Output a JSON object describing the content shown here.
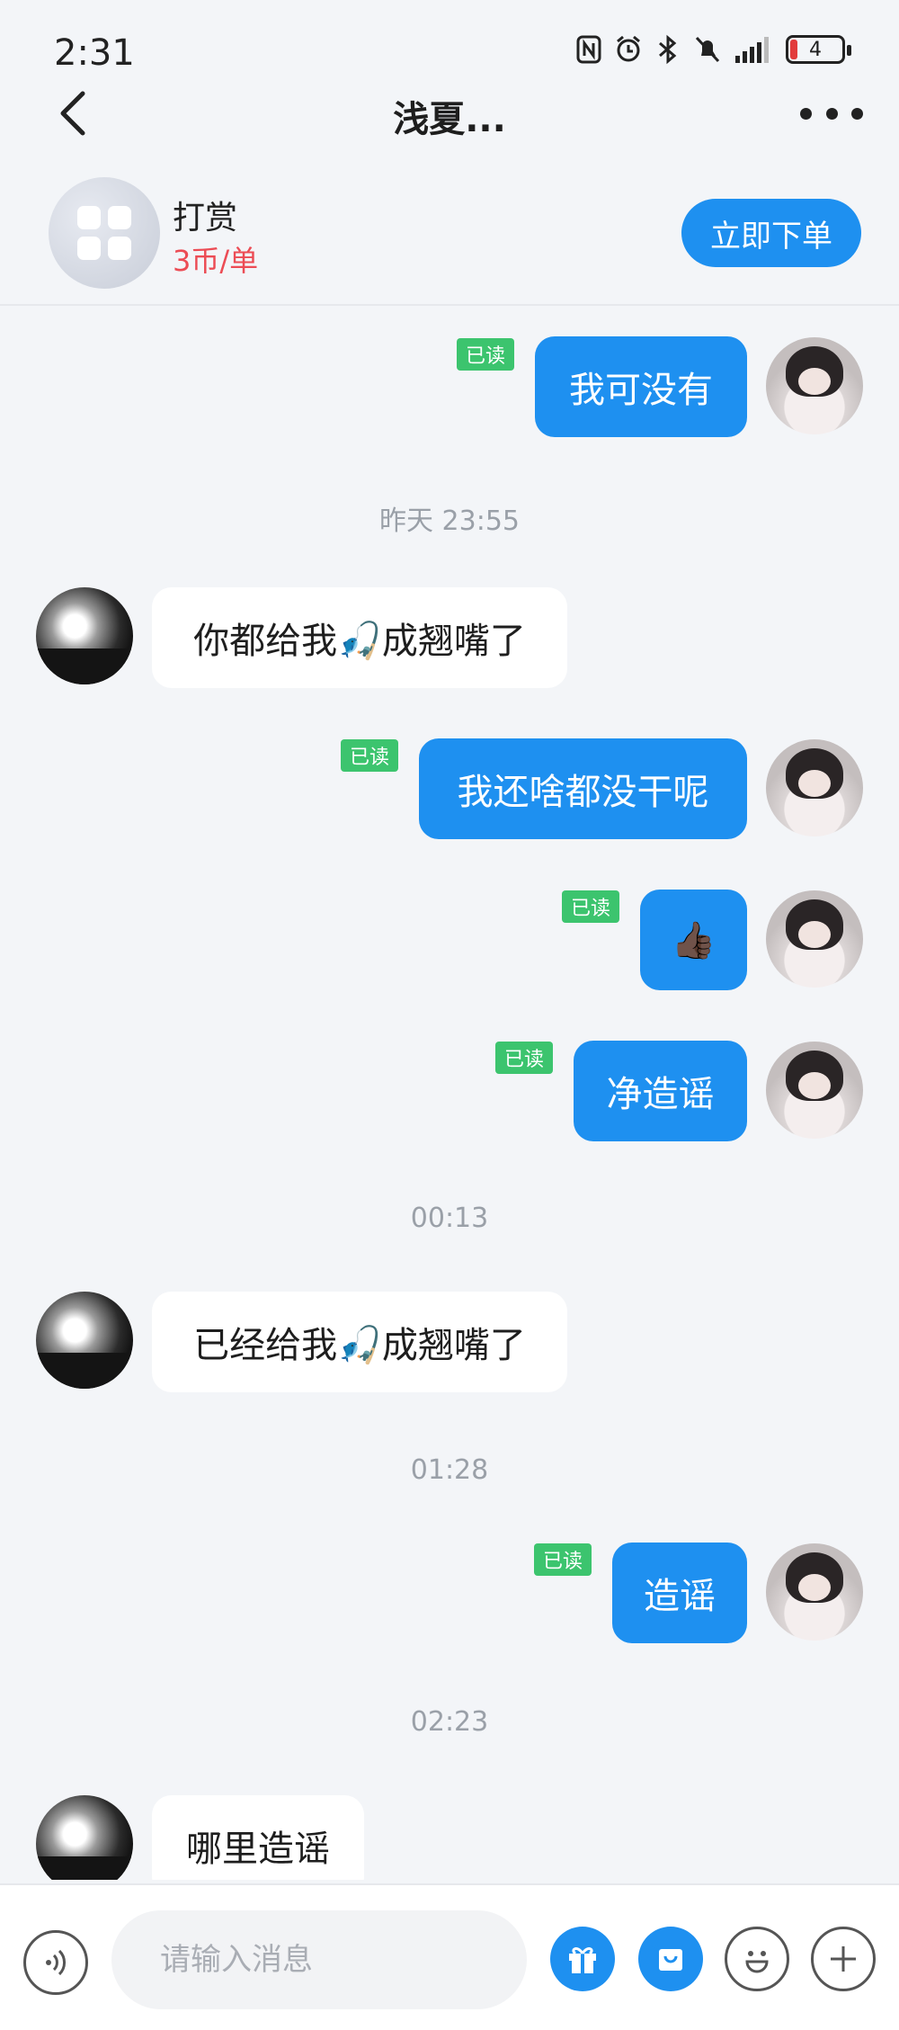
{
  "status": {
    "time": "2:31",
    "battery": "4"
  },
  "nav": {
    "title": "浅夏..."
  },
  "service": {
    "name": "打赏",
    "price": "3币/单",
    "order_label": "立即下单"
  },
  "chat": {
    "read_label": "已读",
    "messages": [
      {
        "side": "me",
        "text": "我可没有"
      },
      {
        "stamp": "昨天 23:55"
      },
      {
        "side": "other",
        "text": "你都给我🎣成翘嘴了"
      },
      {
        "side": "me",
        "text": "我还啥都没干呢"
      },
      {
        "side": "me",
        "text": "👍🏿"
      },
      {
        "side": "me",
        "text": "净造谣"
      },
      {
        "stamp": "00:13"
      },
      {
        "side": "other",
        "text": "已经给我🎣成翘嘴了"
      },
      {
        "stamp": "01:28"
      },
      {
        "side": "me",
        "text": "造谣"
      },
      {
        "stamp": "02:23"
      },
      {
        "side": "other",
        "text": "哪里造谣"
      }
    ]
  },
  "input": {
    "placeholder": "请输入消息"
  },
  "icons": [
    "nfc-icon",
    "alarm-icon",
    "bluetooth-icon",
    "mute-icon",
    "signal-icon",
    "battery-icon",
    "back-icon",
    "more-icon",
    "grid-icon",
    "voice-icon",
    "gift-icon",
    "shop-icon",
    "emoji-icon",
    "plus-icon"
  ],
  "colors": {
    "accent": "#1e90f0",
    "read": "#3cc46e",
    "price": "#ec4c55",
    "background": "#f3f5f8"
  }
}
